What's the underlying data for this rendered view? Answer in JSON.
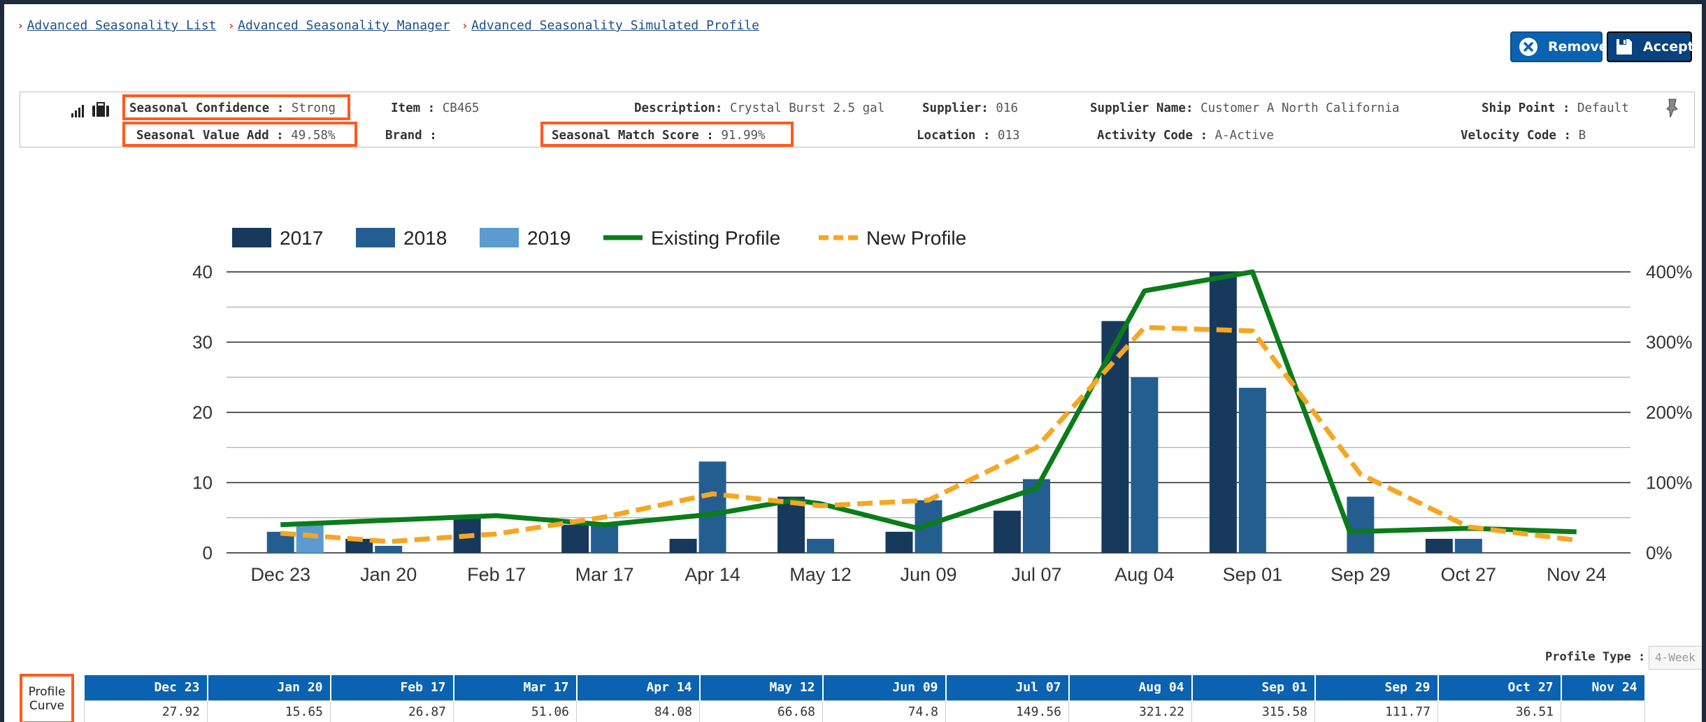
{
  "breadcrumb": [
    {
      "label": "Advanced Seasonality List"
    },
    {
      "label": "Advanced Seasonality Manager"
    },
    {
      "label": "Advanced Seasonality Simulated Profile"
    }
  ],
  "actions": {
    "remove_label": "Remove",
    "accept_label": "Accept"
  },
  "info": {
    "seasonal_confidence_label": "Seasonal Confidence :",
    "seasonal_confidence": "Strong",
    "seasonal_value_add_label": "Seasonal Value Add :",
    "seasonal_value_add": "49.58%",
    "item_label": "Item :",
    "item": "CB465",
    "brand_label": "Brand :",
    "brand": "",
    "description_label": "Description:",
    "description": "Crystal Burst 2.5 gal",
    "seasonal_match_score_label": "Seasonal Match Score :",
    "seasonal_match_score": "91.99%",
    "supplier_label": "Supplier:",
    "supplier": "016",
    "location_label": "Location :",
    "location": "013",
    "supplier_name_label": "Supplier Name:",
    "supplier_name": "Customer A North California",
    "activity_code_label": "Activity Code :",
    "activity_code": "A-Active",
    "ship_point_label": "Ship Point :",
    "ship_point": "Default",
    "velocity_code_label": "Velocity Code :",
    "velocity_code": "B"
  },
  "colors": {
    "accent": "#0b62b0",
    "highlight": "#ff5a1f",
    "bar_2017": "#17395c",
    "bar_2018": "#245e91",
    "bar_2019": "#5b9bd0",
    "existing_profile": "#0a7c1a",
    "new_profile": "#f5a623"
  },
  "chart_data": {
    "type": "bar",
    "categories": [
      "Dec 23",
      "Jan 20",
      "Feb 17",
      "Mar 17",
      "Apr 14",
      "May 12",
      "Jun 09",
      "Jul 07",
      "Aug 04",
      "Sep 01",
      "Sep 29",
      "Oct 27",
      "Nov 24"
    ],
    "ylim": [
      0,
      40
    ],
    "yticks": [
      "0",
      "10",
      "20",
      "30",
      "40"
    ],
    "y2lim": [
      0,
      400
    ],
    "y2ticks": [
      "0%",
      "100%",
      "200%",
      "300%",
      "400%"
    ],
    "grid": true,
    "legend_position": "top-left",
    "series": [
      {
        "name": "2017",
        "type": "bar",
        "values": [
          null,
          2,
          5,
          4,
          2,
          8,
          3,
          6,
          33,
          40,
          null,
          2,
          null
        ]
      },
      {
        "name": "2018",
        "type": "bar",
        "values": [
          3,
          1,
          null,
          4,
          13,
          2,
          7.5,
          10.5,
          25,
          23.5,
          8,
          2,
          null
        ]
      },
      {
        "name": "2019",
        "type": "bar",
        "values": [
          4,
          null,
          null,
          null,
          null,
          null,
          null,
          null,
          null,
          null,
          null,
          null,
          null
        ]
      },
      {
        "name": "Existing Profile",
        "type": "line",
        "axis": "right",
        "points": [
          [
            0,
            40
          ],
          [
            2,
            53
          ],
          [
            3,
            40
          ],
          [
            4,
            55
          ],
          [
            4.75,
            75
          ],
          [
            5,
            70
          ],
          [
            5.9,
            35
          ],
          [
            7,
            92
          ],
          [
            8,
            373
          ],
          [
            9,
            400
          ],
          [
            9.9,
            30
          ],
          [
            11,
            35
          ],
          [
            12,
            30
          ]
        ]
      },
      {
        "name": "New Profile",
        "type": "line",
        "axis": "right",
        "dashed": true,
        "points": [
          [
            0,
            28
          ],
          [
            1,
            16
          ],
          [
            2,
            27
          ],
          [
            3,
            51
          ],
          [
            4,
            84
          ],
          [
            5,
            67
          ],
          [
            6,
            75
          ],
          [
            7,
            150
          ],
          [
            8,
            321
          ],
          [
            9,
            316
          ],
          [
            10,
            112
          ],
          [
            11,
            37
          ],
          [
            12,
            18
          ]
        ]
      }
    ]
  },
  "profile_type": {
    "label": "Profile Type :",
    "value": "4-Week"
  },
  "profile_curve": {
    "label_line1": "Profile",
    "label_line2": "Curve",
    "headers": [
      "Dec 23",
      "Jan 20",
      "Feb 17",
      "Mar 17",
      "Apr 14",
      "May 12",
      "Jun 09",
      "Jul 07",
      "Aug 04",
      "Sep 01",
      "Sep 29",
      "Oct 27",
      "Nov 24"
    ],
    "values": [
      "27.92",
      "15.65",
      "26.87",
      "51.06",
      "84.08",
      "66.68",
      "74.8",
      "149.56",
      "321.22",
      "315.58",
      "111.77",
      "36.51",
      ""
    ]
  }
}
